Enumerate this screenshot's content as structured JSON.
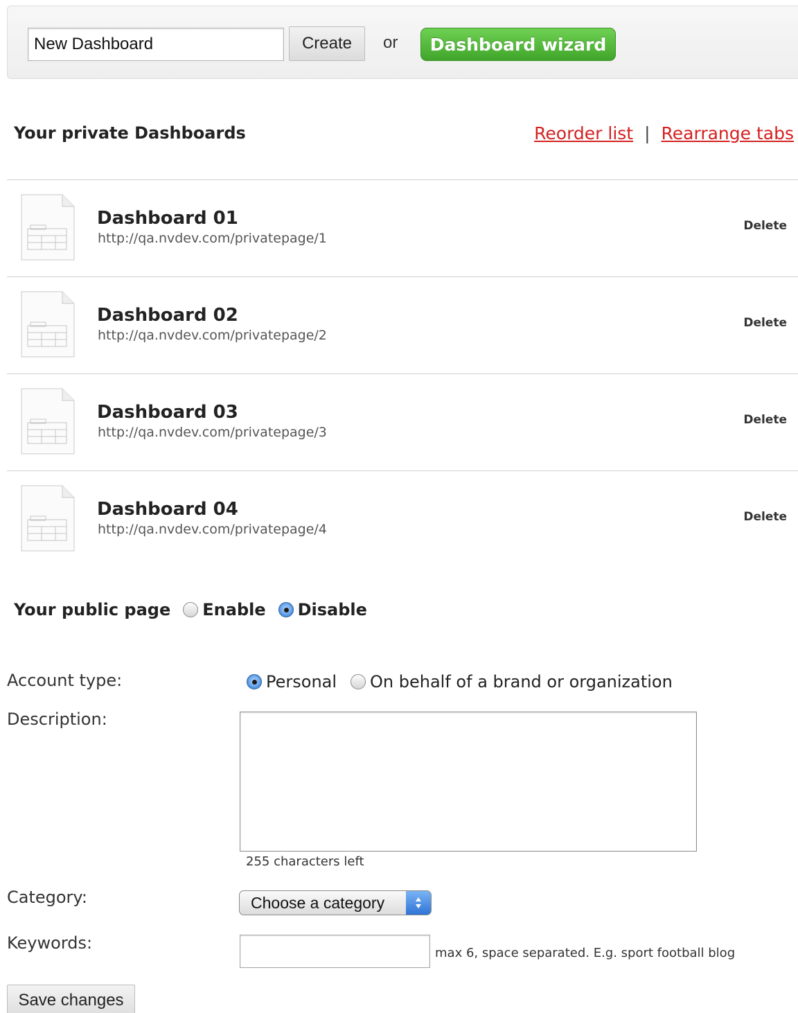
{
  "create_bar": {
    "input_value": "New Dashboard",
    "create_label": "Create",
    "or_label": "or",
    "wizard_label": "Dashboard wizard"
  },
  "private": {
    "title": "Your private Dashboards",
    "reorder_label": "Reorder list",
    "separator": "|",
    "rearrange_label": "Rearrange tabs",
    "delete_label": "Delete",
    "dashboards": [
      {
        "name": "Dashboard 01",
        "url": "http://qa.nvdev.com/privatepage/1"
      },
      {
        "name": "Dashboard 02",
        "url": "http://qa.nvdev.com/privatepage/2"
      },
      {
        "name": "Dashboard 03",
        "url": "http://qa.nvdev.com/privatepage/3"
      },
      {
        "name": "Dashboard 04",
        "url": "http://qa.nvdev.com/privatepage/4"
      }
    ]
  },
  "public_page": {
    "label": "Your public page",
    "enable_label": "Enable",
    "disable_label": "Disable",
    "selected": "Disable"
  },
  "form": {
    "account_type_label": "Account type:",
    "personal_label": "Personal",
    "brand_label": "On behalf of a brand or organization",
    "account_selected": "Personal",
    "description_label": "Description:",
    "description_value": "",
    "chars_left": "255 characters left",
    "category_label": "Category:",
    "category_selected": "Choose a category",
    "keywords_label": "Keywords:",
    "keywords_value": "",
    "keywords_hint": "max 6, space separated. E.g. sport football blog",
    "save_label": "Save changes"
  },
  "colors": {
    "link_red": "#d42020",
    "wizard_green": "#4db834",
    "radio_blue": "#2f6fc4"
  },
  "icons": {
    "dashboard_thumb": "dashboard-thumbnail-icon",
    "select_arrows": "select-arrows-icon"
  }
}
